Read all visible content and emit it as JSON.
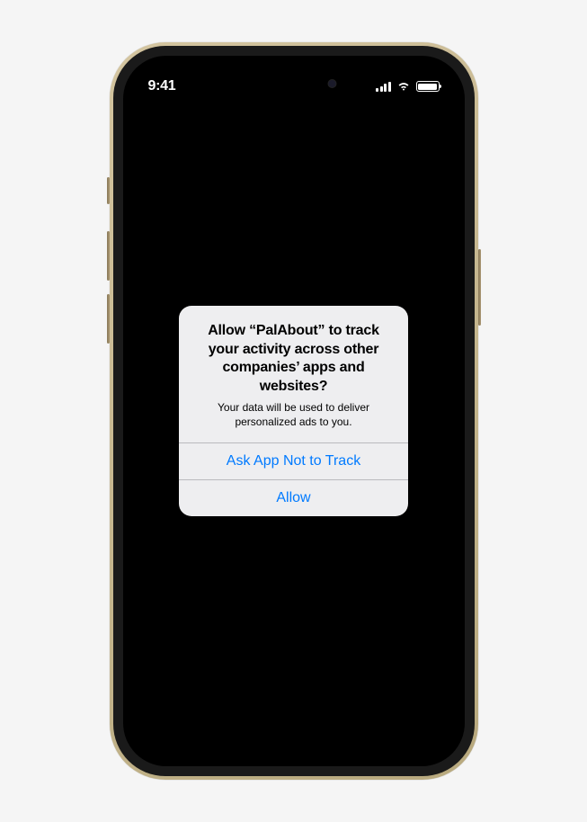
{
  "status_bar": {
    "time": "9:41"
  },
  "dialog": {
    "title": "Allow “PalAbout” to track your activity across other companies’ apps and websites?",
    "message": "Your data will be used to deliver personalized ads to you.",
    "deny_label": "Ask App Not to Track",
    "allow_label": "Allow"
  }
}
